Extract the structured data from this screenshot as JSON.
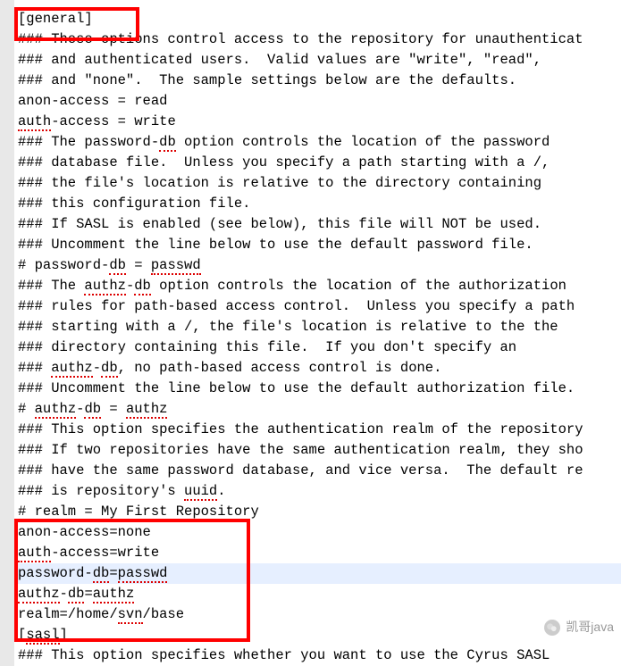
{
  "lines": [
    {
      "segments": [
        {
          "t": "[general]"
        }
      ],
      "highlight": false
    },
    {
      "segments": [
        {
          "t": "### These options control access to the repository for unauthenticat"
        }
      ],
      "highlight": false
    },
    {
      "segments": [
        {
          "t": "### and authenticated users.  Valid values are \"write\", \"read\","
        }
      ],
      "highlight": false
    },
    {
      "segments": [
        {
          "t": "### and \"none\".  The sample settings below are the defaults."
        }
      ],
      "highlight": false
    },
    {
      "segments": [
        {
          "t": "anon-access = read"
        }
      ],
      "highlight": false
    },
    {
      "segments": [
        {
          "t": "",
          "u": false
        },
        {
          "t": "auth",
          "u": true
        },
        {
          "t": "-access = write"
        }
      ],
      "highlight": false
    },
    {
      "segments": [
        {
          "t": "### The password-"
        },
        {
          "t": "db",
          "u": true
        },
        {
          "t": " option controls the location of the password"
        }
      ],
      "highlight": false
    },
    {
      "segments": [
        {
          "t": "### database file.  Unless you specify a path starting with a /,"
        }
      ],
      "highlight": false
    },
    {
      "segments": [
        {
          "t": "### the file's location is relative to the directory containing"
        }
      ],
      "highlight": false
    },
    {
      "segments": [
        {
          "t": "### this configuration file."
        }
      ],
      "highlight": false
    },
    {
      "segments": [
        {
          "t": "### If SASL is enabled (see below), this file will NOT be used."
        }
      ],
      "highlight": false
    },
    {
      "segments": [
        {
          "t": "### Uncomment the line below to use the default password file."
        }
      ],
      "highlight": false
    },
    {
      "segments": [
        {
          "t": "# password-"
        },
        {
          "t": "db",
          "u": true
        },
        {
          "t": " = "
        },
        {
          "t": "passwd",
          "u": true
        }
      ],
      "highlight": false
    },
    {
      "segments": [
        {
          "t": "### The "
        },
        {
          "t": "authz",
          "u": true
        },
        {
          "t": "-"
        },
        {
          "t": "db",
          "u": true
        },
        {
          "t": " option controls the location of the authorization"
        }
      ],
      "highlight": false
    },
    {
      "segments": [
        {
          "t": "### rules for path-based access control.  Unless you specify a path"
        }
      ],
      "highlight": false
    },
    {
      "segments": [
        {
          "t": "### starting with a /, the file's location is relative to the the"
        }
      ],
      "highlight": false
    },
    {
      "segments": [
        {
          "t": "### directory containing this file.  If you don't specify an"
        }
      ],
      "highlight": false
    },
    {
      "segments": [
        {
          "t": "### "
        },
        {
          "t": "authz",
          "u": true
        },
        {
          "t": "-"
        },
        {
          "t": "db",
          "u": true
        },
        {
          "t": ", no path-based access control is done."
        }
      ],
      "highlight": false
    },
    {
      "segments": [
        {
          "t": "### Uncomment the line below to use the default authorization file."
        }
      ],
      "highlight": false
    },
    {
      "segments": [
        {
          "t": "# "
        },
        {
          "t": "authz",
          "u": true
        },
        {
          "t": "-"
        },
        {
          "t": "db",
          "u": true
        },
        {
          "t": " = "
        },
        {
          "t": "authz",
          "u": true
        }
      ],
      "highlight": false
    },
    {
      "segments": [
        {
          "t": "### This option specifies the authentication realm of the repository"
        }
      ],
      "highlight": false
    },
    {
      "segments": [
        {
          "t": "### If two repositories have the same authentication realm, they sho"
        }
      ],
      "highlight": false
    },
    {
      "segments": [
        {
          "t": "### have the same password database, and vice versa.  The default re"
        }
      ],
      "highlight": false
    },
    {
      "segments": [
        {
          "t": "### is repository's "
        },
        {
          "t": "uuid",
          "u": true
        },
        {
          "t": "."
        }
      ],
      "highlight": false
    },
    {
      "segments": [
        {
          "t": "# realm = My First Repository"
        }
      ],
      "highlight": false
    },
    {
      "segments": [
        {
          "t": "anon-access=none"
        }
      ],
      "highlight": false
    },
    {
      "segments": [
        {
          "t": "",
          "u": false
        },
        {
          "t": "auth",
          "u": true
        },
        {
          "t": "-access=write"
        }
      ],
      "highlight": false
    },
    {
      "segments": [
        {
          "t": "password-"
        },
        {
          "t": "db",
          "u": true
        },
        {
          "t": "="
        },
        {
          "t": "passwd",
          "u": true
        }
      ],
      "highlight": true
    },
    {
      "segments": [
        {
          "t": "",
          "u": false
        },
        {
          "t": "authz",
          "u": true
        },
        {
          "t": "-"
        },
        {
          "t": "db",
          "u": true
        },
        {
          "t": "="
        },
        {
          "t": "authz",
          "u": true
        }
      ],
      "highlight": false
    },
    {
      "segments": [
        {
          "t": "realm=/home/"
        },
        {
          "t": "svn",
          "u": true
        },
        {
          "t": "/base"
        }
      ],
      "highlight": false
    },
    {
      "segments": [
        {
          "t": "["
        },
        {
          "t": "sasl",
          "u": true
        },
        {
          "t": "]"
        }
      ],
      "highlight": false
    },
    {
      "segments": [
        {
          "t": "### This option specifies whether you want to use the Cyrus SASL"
        }
      ],
      "highlight": false
    }
  ],
  "boxes": {
    "top": {
      "enabled": true
    },
    "bottom": {
      "enabled": true
    }
  },
  "watermark": {
    "text": "凯哥java"
  }
}
